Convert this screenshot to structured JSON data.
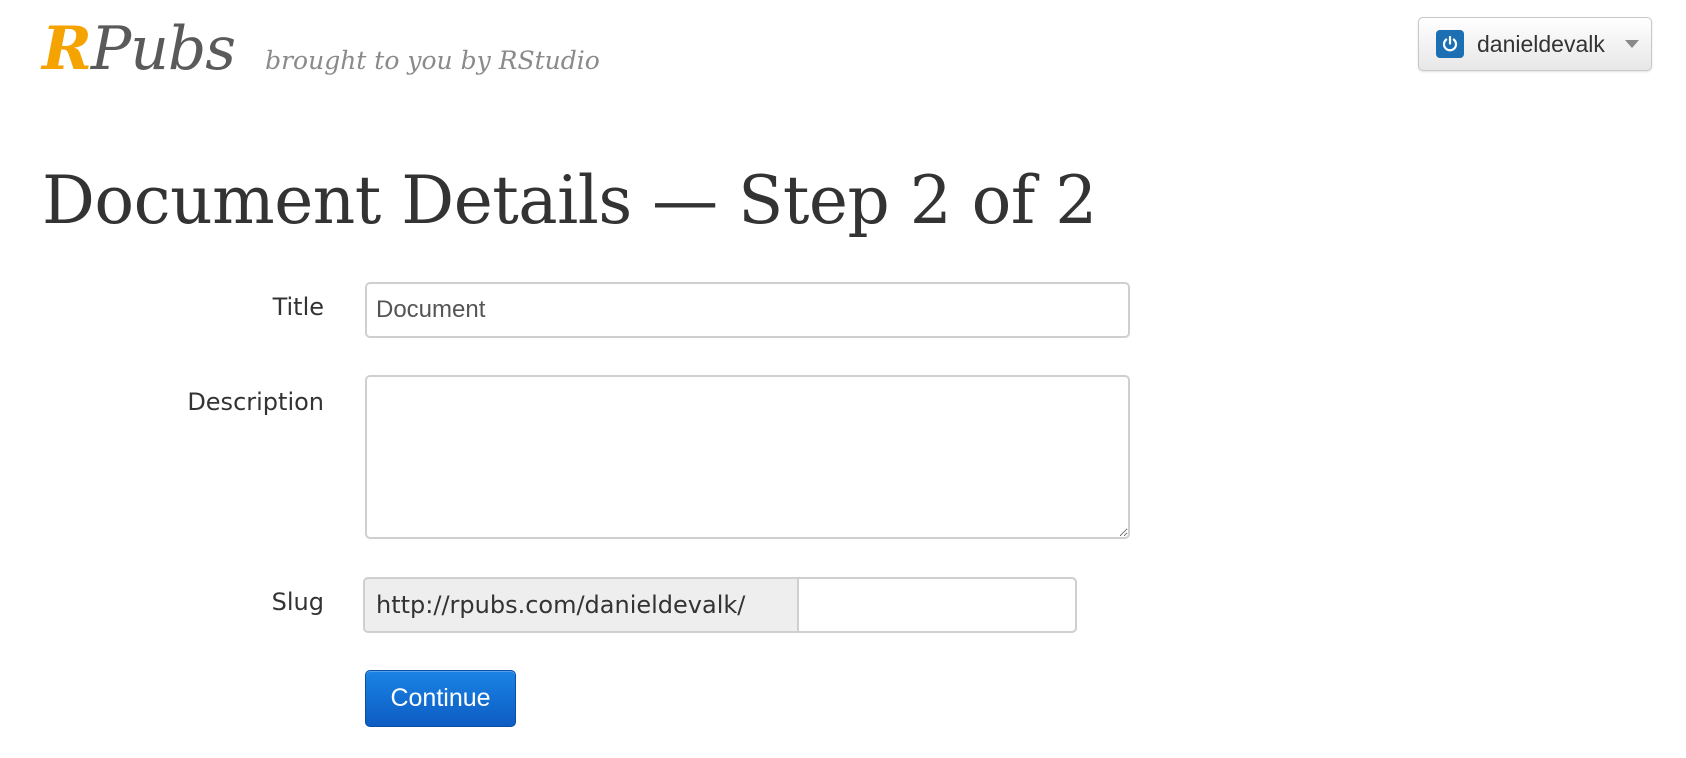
{
  "header": {
    "logo": {
      "first_letter": "R",
      "rest": "Pubs"
    },
    "tagline": "brought to you by RStudio",
    "user_menu": {
      "username": "danieldevalk",
      "icon": "power-icon",
      "dropdown_icon": "caret-down-icon"
    }
  },
  "page": {
    "title": "Document Details — Step 2 of 2"
  },
  "form": {
    "title": {
      "label": "Title",
      "value": "Document"
    },
    "description": {
      "label": "Description",
      "value": ""
    },
    "slug": {
      "label": "Slug",
      "prefix": "http://rpubs.com/danieldevalk/",
      "value": ""
    },
    "submit_label": "Continue"
  },
  "colors": {
    "logo_accent": "#f5a300",
    "primary_button": "#0d6fd6",
    "user_icon": "#1c6fb2"
  }
}
